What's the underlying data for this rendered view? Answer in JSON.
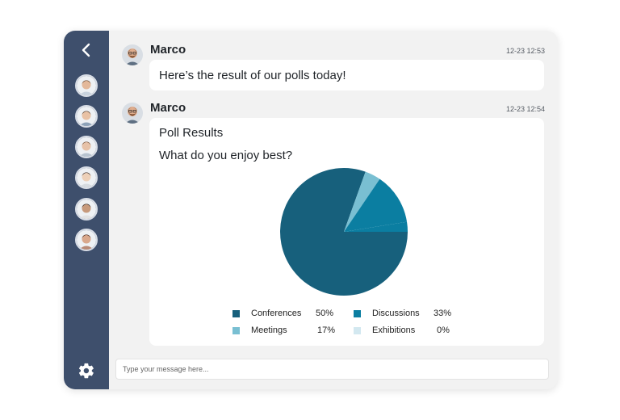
{
  "sidebar": {
    "contacts": [
      {
        "name": "contact-1",
        "skin": "#e3b89a",
        "hair": "#5a3a22",
        "shirt": "#c9d3de"
      },
      {
        "name": "contact-2",
        "skin": "#e8c1a4",
        "hair": "#3b2a1d",
        "shirt": "#8da2b8"
      },
      {
        "name": "contact-3",
        "skin": "#e6c2a8",
        "hair": "#6b4a33",
        "shirt": "#b7c3cf"
      },
      {
        "name": "contact-4",
        "skin": "#edd0b8",
        "hair": "#2b2320",
        "shirt": "#d6dbe0"
      },
      {
        "name": "contact-5",
        "skin": "#c79a7c",
        "hair": "#231a16",
        "shirt": "#e2e2e2"
      },
      {
        "name": "contact-6",
        "skin": "#d9a88c",
        "hair": "#3a1f16",
        "shirt": "#b98a76"
      }
    ]
  },
  "messages": [
    {
      "sender": "Marco",
      "time": "12-23 12:53",
      "text": "Here’s the result of our polls today!"
    },
    {
      "sender": "Marco",
      "time": "12-23 12:54",
      "poll_title": "Poll Results",
      "question": "What do you enjoy best?"
    }
  ],
  "chart_data": {
    "type": "pie",
    "slices": [
      {
        "label": "Conferences",
        "value": 50,
        "display": "50%",
        "color": "#17607c"
      },
      {
        "label": "Discussions",
        "value": 33,
        "display": "33%",
        "color": "#0b7ea1"
      },
      {
        "label": "Meetings",
        "value": 17,
        "display": "17%",
        "color": "#79bfd2"
      },
      {
        "label": "Exhibitions",
        "value": 0,
        "display": "0%",
        "color": "#d3e8f0"
      }
    ],
    "rendered_fractions": [
      0.805,
      0.13,
      0.04,
      0.0
    ],
    "legend_position": "bottom"
  },
  "composer": {
    "placeholder": "Type your message here..."
  }
}
